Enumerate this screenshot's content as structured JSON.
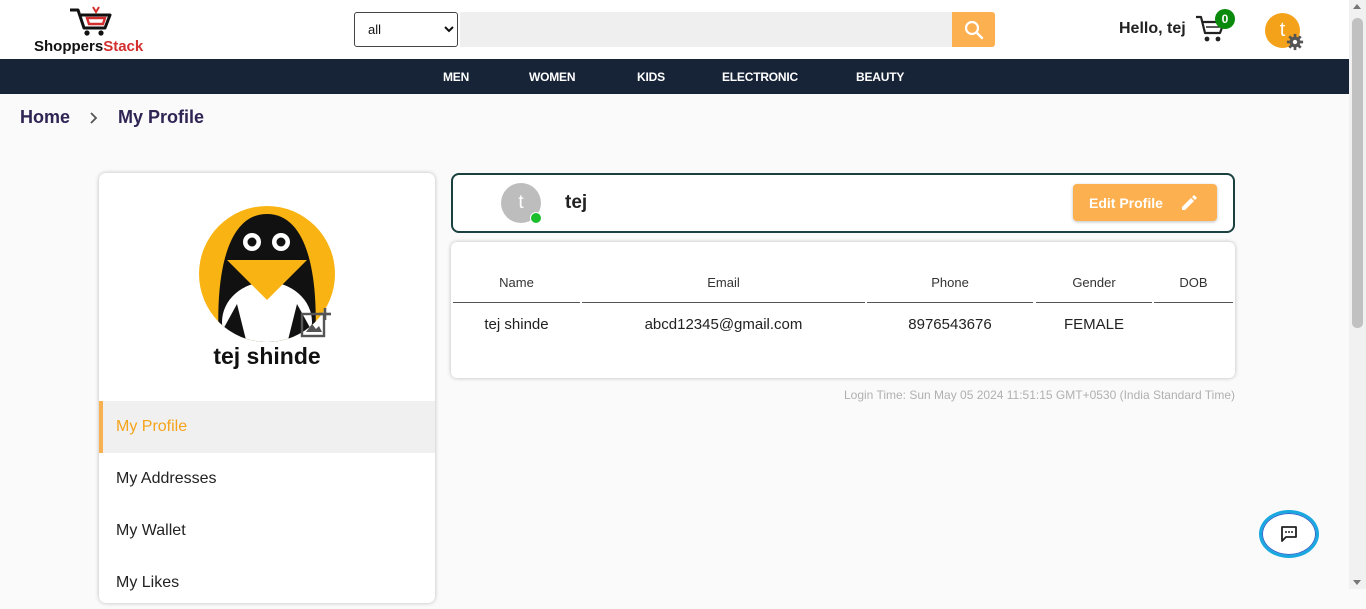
{
  "header": {
    "logo": {
      "part1": "Shoppers",
      "part2": "Stack"
    },
    "category_select": {
      "selected": "all"
    },
    "search": {
      "placeholder": ""
    },
    "greeting": "Hello, tej",
    "cart_count": "0",
    "user_initial": "t"
  },
  "nav": {
    "items": [
      "MEN",
      "WOMEN",
      "KIDS",
      "ELECTRONIC",
      "BEAUTY"
    ]
  },
  "breadcrumb": {
    "home": "Home",
    "current": "My Profile"
  },
  "sidebar": {
    "profile_name": "tej shinde",
    "items": [
      {
        "label": "My Profile",
        "active": true
      },
      {
        "label": "My Addresses",
        "active": false
      },
      {
        "label": "My Wallet",
        "active": false
      },
      {
        "label": "My Likes",
        "active": false
      }
    ]
  },
  "profile_card": {
    "avatar_initial": "t",
    "name": "tej",
    "edit_label": "Edit Profile"
  },
  "info_table": {
    "headers": [
      "Name",
      "Email",
      "Phone",
      "Gender",
      "DOB"
    ],
    "row": [
      "tej shinde",
      "abcd12345@gmail.com",
      "8976543676",
      "FEMALE",
      ""
    ]
  },
  "login_time": "Login Time: Sun May 05 2024 11:51:15 GMT+0530 (India Standard Time)",
  "colors": {
    "accent_orange": "#fcb050",
    "navbar": "#172337",
    "card_border": "#1b4040",
    "online": "#1cbf2b"
  },
  "icons": {
    "search": "search-icon",
    "cart": "cart-icon",
    "settings": "gear-icon",
    "edit": "pencil-icon",
    "add_photo": "add-photo-icon",
    "chat": "chat-icon",
    "breadcrumb_separator": "chevron-right-icon"
  }
}
